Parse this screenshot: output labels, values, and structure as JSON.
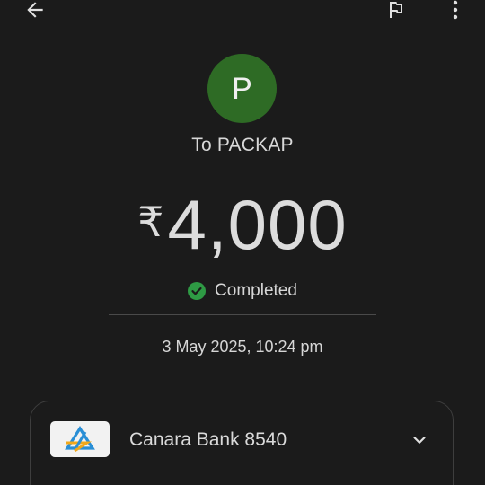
{
  "header": {
    "back_icon": "arrow-left-icon",
    "flag_icon": "flag-icon",
    "more_icon": "more-vert-icon"
  },
  "payee": {
    "initial": "P",
    "avatar_color": "#2e6b25",
    "label": "To PACKAP"
  },
  "payment": {
    "currency_symbol": "₹",
    "amount": "4,000",
    "status": "Completed",
    "status_color": "#2e9a44",
    "datetime": "3 May 2025, 10:24 pm"
  },
  "account": {
    "bank_logo_icon": "canara-bank-logo",
    "bank_name": "Canara Bank 8540",
    "expand_icon": "chevron-down-icon"
  }
}
